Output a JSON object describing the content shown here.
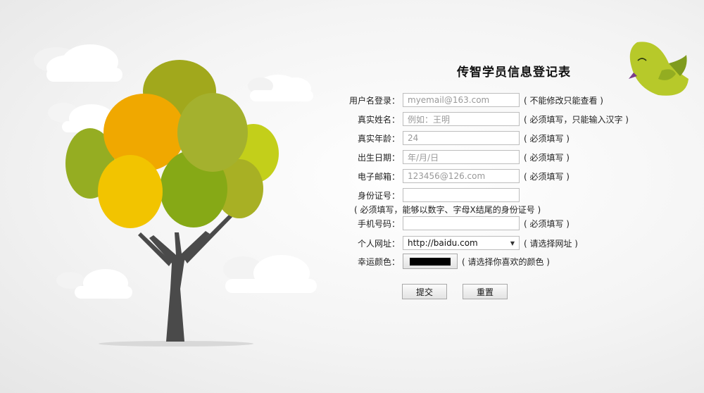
{
  "form": {
    "title": "传智学员信息登记表",
    "fields": [
      {
        "label": "用户名登录：",
        "placeholder": "myemail@163.com",
        "hint": "( 不能修改只能查看 )"
      },
      {
        "label": "真实姓名：",
        "placeholder": "例如：王明",
        "hint": "( 必须填写，只能输入汉字 )"
      },
      {
        "label": "真实年龄：",
        "placeholder": "24",
        "hint": "( 必须填写 )"
      },
      {
        "label": "出生日期：",
        "placeholder": "年/月/日",
        "hint": "( 必须填写 )"
      },
      {
        "label": "电子邮箱：",
        "placeholder": "123456@126.com",
        "hint": "( 必须填写 )"
      },
      {
        "label": "身份证号：",
        "placeholder": "",
        "hint": ""
      },
      {
        "label": "手机号码：",
        "placeholder": "",
        "hint": "( 必须填写 )"
      }
    ],
    "id_note": "( 必须填写，能够以数字、字母X结尾的身份证号 )",
    "website": {
      "label": "个人网址：",
      "selected": "http://baidu.com",
      "hint": "( 请选择网址 )"
    },
    "color": {
      "label": "幸运颜色：",
      "value": "#000000",
      "hint": "( 请选择你喜欢的颜色 )"
    },
    "submit_label": "提交",
    "reset_label": "重置"
  }
}
